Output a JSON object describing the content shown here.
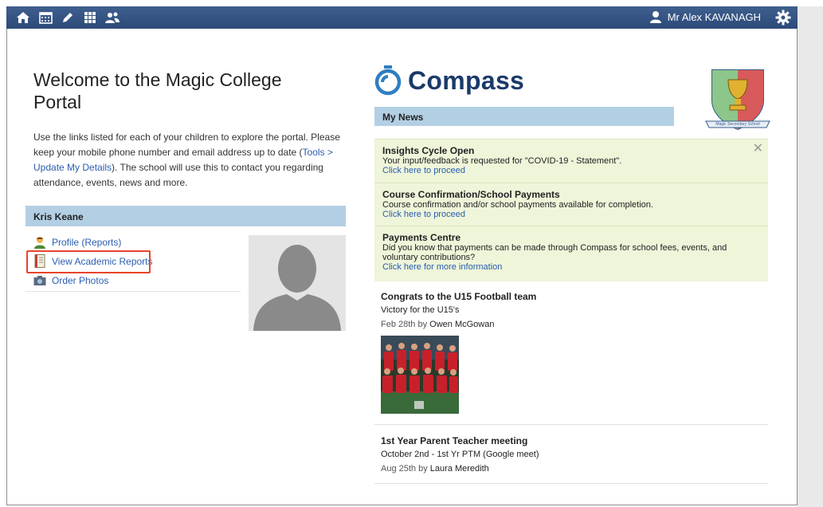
{
  "topbar": {
    "icons": [
      "home-icon",
      "calendar-icon",
      "pencil-icon",
      "grid-icon",
      "people-icon"
    ],
    "user_name": "Mr Alex KAVANAGH",
    "accent": "#34527f"
  },
  "welcome": {
    "title": "Welcome to the Magic College Portal",
    "intro_text_1": "Use the links listed for each of your children to explore the portal. Please keep your mobile phone number and email address up to date (",
    "intro_link": "Tools > Update My Details",
    "intro_text_2": "). The school will use this to contact you regarding attendance, events, news and more."
  },
  "child": {
    "name": "Kris Keane",
    "links": [
      {
        "label": "Profile (Reports)",
        "icon": "profile-icon"
      },
      {
        "label": "View Academic Reports",
        "icon": "report-book-icon"
      },
      {
        "label": "Order Photos",
        "icon": "camera-icon"
      }
    ]
  },
  "brand": {
    "name": "Compass",
    "school_name": "Magic Secondary School",
    "color": "#1b3a6b"
  },
  "news": {
    "header": "My News",
    "alerts": [
      {
        "title": "Insights Cycle Open",
        "body": "Your input/feedback is requested for \"COVID-19 - Statement\".",
        "link": "Click here to proceed"
      },
      {
        "title": "Course Confirmation/School Payments",
        "body": "Course confirmation and/or school payments available for completion.",
        "link": "Click here to proceed"
      },
      {
        "title": "Payments Centre",
        "body": "Did you know that payments can be made through Compass for school fees, events, and voluntary contributions?",
        "link": "Click here for more information"
      }
    ],
    "items": [
      {
        "title": "Congrats to the U15 Football team",
        "subtitle": "Victory for the U15's",
        "date": "Feb 28th",
        "by": "by",
        "author": "Owen McGowan"
      },
      {
        "title": "1st Year Parent Teacher meeting",
        "subtitle": "October 2nd - 1st Yr PTM (Google meet)",
        "date": "Aug 25th",
        "by": "by",
        "author": "Laura Meredith"
      }
    ]
  }
}
